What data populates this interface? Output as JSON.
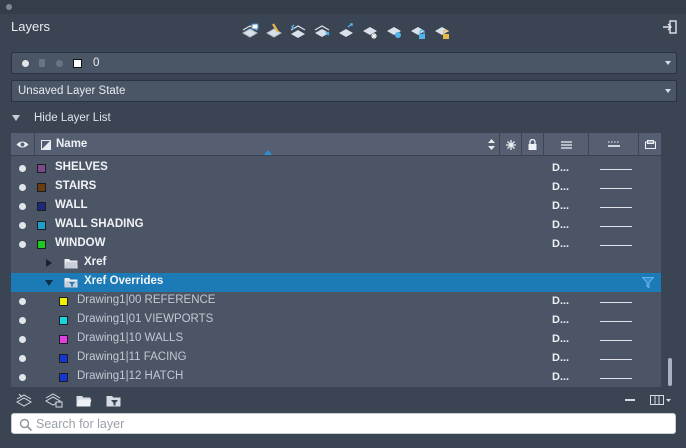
{
  "panel": {
    "title": "Layers"
  },
  "toolbar": {
    "tools": [
      "layer-properties-icon",
      "set-current-icon",
      "match-layer-icon",
      "previous-layer-icon",
      "isolate-icon",
      "freeze-icon",
      "off-icon",
      "lock-icon",
      "unlock-icon"
    ]
  },
  "current_layer": {
    "name": "0"
  },
  "layer_state": {
    "value": "Unsaved Layer State"
  },
  "layer_list_toggle": {
    "label": "Hide Layer List"
  },
  "columns": {
    "name": "Name"
  },
  "layers": [
    {
      "name": "SHELVES",
      "color": "#7a4a8a",
      "linetype": "D..."
    },
    {
      "name": "STAIRS",
      "color": "#6b3b12",
      "linetype": "D..."
    },
    {
      "name": "WALL",
      "color": "#1d2a7a",
      "linetype": "D..."
    },
    {
      "name": "WALL SHADING",
      "color": "#1fa0c8",
      "linetype": "D..."
    },
    {
      "name": "WINDOW",
      "color": "#1ec81e",
      "linetype": "D..."
    }
  ],
  "groups": [
    {
      "name": "Xref"
    },
    {
      "name": "Xref Overrides"
    }
  ],
  "xref_layers": [
    {
      "name": "Drawing1|00 REFERENCE",
      "color": "#f2f200",
      "linetype": "D..."
    },
    {
      "name": "Drawing1|01 VIEWPORTS",
      "color": "#16d6e0",
      "linetype": "D..."
    },
    {
      "name": "Drawing1|10 WALLS",
      "color": "#e040e0",
      "linetype": "D..."
    },
    {
      "name": "Drawing1|11 FACING",
      "color": "#1636d0",
      "linetype": "D..."
    },
    {
      "name": "Drawing1|12 HATCH",
      "color": "#1636d0",
      "linetype": "D..."
    }
  ],
  "search": {
    "placeholder": "Search for layer"
  }
}
